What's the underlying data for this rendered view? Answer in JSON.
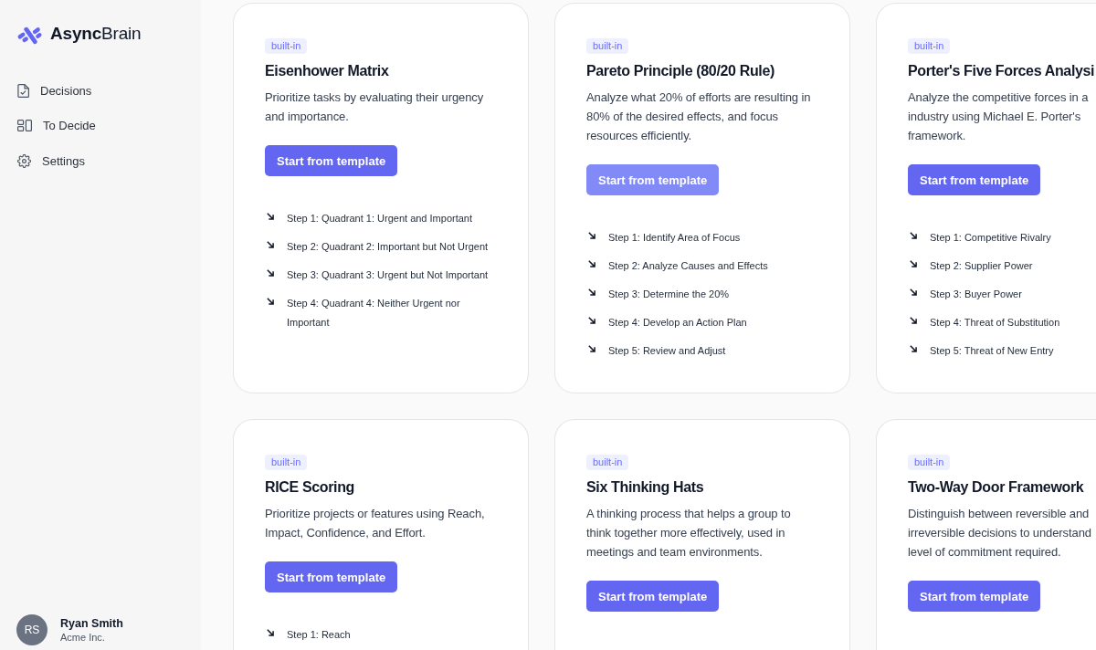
{
  "sidebar": {
    "logo": "**Async**Brain",
    "nav": [
      {
        "label": "Decisions"
      },
      {
        "label": "To Decide"
      },
      {
        "label": "Settings"
      }
    ],
    "user": {
      "initials": "RS",
      "name": "Ryan Smith",
      "company": "Acme Inc."
    }
  },
  "templates": [
    {
      "tag": "built-in",
      "title": "Eisenhower Matrix",
      "description": "Prioritize tasks by evaluating their urgency and importance.",
      "button": {
        "label": "Start from template",
        "hovered": false
      },
      "steps": [
        "Step 1: Quadrant 1: Urgent and Important",
        "Step 2: Quadrant 2: Important but Not Urgent",
        "Step 3: Quadrant 3: Urgent but Not Important",
        "Step 4: Quadrant 4: Neither Urgent nor Important"
      ]
    },
    {
      "tag": "built-in",
      "title": "Pareto Principle (80/20 Rule)",
      "description": "Analyze what 20% of efforts are resulting in 80% of the desired effects, and focus resources efficiently.",
      "button": {
        "label": "Start from template",
        "hovered": true
      },
      "steps": [
        "Step 1: Identify Area of Focus",
        "Step 2: Analyze Causes and Effects",
        "Step 3: Determine the 20%",
        "Step 4: Develop an Action Plan",
        "Step 5: Review and Adjust"
      ]
    },
    {
      "tag": "built-in",
      "title": "Porter's Five Forces Analysi",
      "description": "Analyze the competitive forces in a industry using Michael E. Porter's framework.",
      "button": {
        "label": "Start from template",
        "hovered": false
      },
      "steps": [
        "Step 1: Competitive Rivalry",
        "Step 2: Supplier Power",
        "Step 3: Buyer Power",
        "Step 4: Threat of Substitution",
        "Step 5: Threat of New Entry"
      ]
    },
    {
      "tag": "built-in",
      "title": "RICE Scoring",
      "description": "Prioritize projects or features using Reach, Impact, Confidence, and Effort.",
      "button": {
        "label": "Start from template",
        "hovered": false
      },
      "steps": [
        "Step 1: Reach"
      ]
    },
    {
      "tag": "built-in",
      "title": "Six Thinking Hats",
      "description": "A thinking process that helps a group to think together more effectively, used in meetings and team environments.",
      "button": {
        "label": "Start from template",
        "hovered": false
      }
    },
    {
      "tag": "built-in",
      "title": "Two-Way Door Framework",
      "description": "Distinguish between reversible and irreversible decisions to understand level of commitment required.",
      "button": {
        "label": "Start from template",
        "hovered": false
      }
    }
  ]
}
